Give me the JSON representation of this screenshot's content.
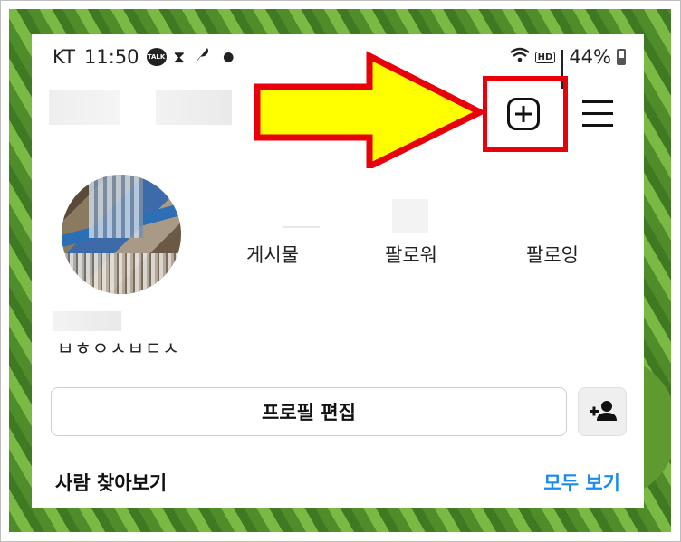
{
  "status_bar": {
    "carrier": "KT",
    "time": "11:50",
    "talk_badge": "TALK",
    "notification_icons": [
      "kakaotalk-icon",
      "hourglass-icon",
      "feather-icon"
    ],
    "network_badge": "HD",
    "battery": "44%"
  },
  "profile": {
    "stats": [
      {
        "label": "게시물"
      },
      {
        "label": "팔로워"
      },
      {
        "label": "팔로잉"
      }
    ],
    "bio_text": "ㅂㅎㅇㅅㅂㄷㅅ",
    "edit_profile_label": "프로필 편집"
  },
  "discover": {
    "title": "사람 찾아보기",
    "see_all": "모두 보기"
  },
  "annotation": {
    "highlight_color": "#e8000a",
    "arrow_fill": "#ffff00",
    "arrow_stroke": "#e8000a"
  }
}
